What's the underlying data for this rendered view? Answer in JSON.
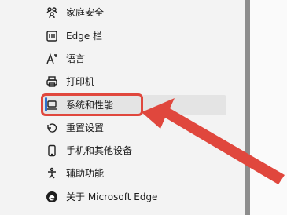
{
  "settings_menu": {
    "items": [
      {
        "label": "家庭安全",
        "icon": "family-safety-icon"
      },
      {
        "label": "Edge 栏",
        "icon": "edge-bar-icon"
      },
      {
        "label": "语言",
        "icon": "language-icon"
      },
      {
        "label": "打印机",
        "icon": "printer-icon"
      },
      {
        "label": "系统和性能",
        "icon": "laptop-icon",
        "active": true
      },
      {
        "label": "重置设置",
        "icon": "reset-icon"
      },
      {
        "label": "手机和其他设备",
        "icon": "phone-icon"
      },
      {
        "label": "辅助功能",
        "icon": "accessibility-icon"
      },
      {
        "label": "关于 Microsoft Edge",
        "icon": "edge-logo-icon"
      }
    ]
  },
  "annotation": {
    "highlight_color": "#e0473d",
    "accent_color": "#2f6fcf"
  }
}
